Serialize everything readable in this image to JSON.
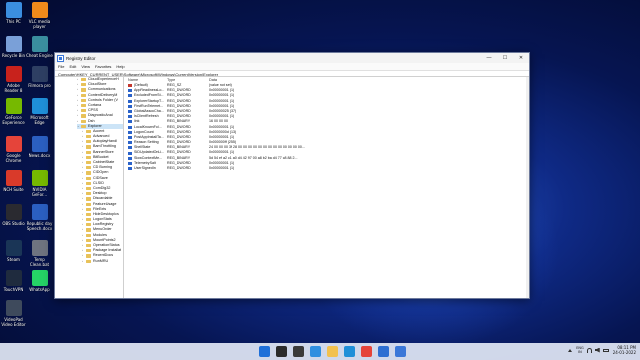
{
  "desktop": {
    "icons": [
      {
        "label": "This PC",
        "color": "#3b8ee0"
      },
      {
        "label": "VLC media player",
        "color": "#f08a1b"
      },
      {
        "label": "Recycle Bin",
        "color": "#7aa0d8"
      },
      {
        "label": "Cheat Engine",
        "color": "#3a8e9e"
      },
      {
        "label": "Adobe Reader 8",
        "color": "#c8221c"
      },
      {
        "label": "Filmora pro",
        "color": "#2e3f63"
      },
      {
        "label": "GeForce Experience",
        "color": "#76b900"
      },
      {
        "label": "Microsoft Edge",
        "color": "#1f8fd8"
      },
      {
        "label": "Google Chrome",
        "color": "#e5443a"
      },
      {
        "label": "News.docx",
        "color": "#2b5fc1"
      },
      {
        "label": "NCH Suite",
        "color": "#d93a2a"
      },
      {
        "label": "NVIDIA GeFor...",
        "color": "#76b900"
      },
      {
        "label": "OBS Studio",
        "color": "#2a2a30"
      },
      {
        "label": "Republic day Speech.docx",
        "color": "#2b5fc1"
      },
      {
        "label": "Steam",
        "color": "#1a3556"
      },
      {
        "label": "Temp Clean.bat",
        "color": "#6f7480"
      },
      {
        "label": "TouchVPN",
        "color": "#1f2b3e"
      },
      {
        "label": "WhatsApp",
        "color": "#25d366"
      },
      {
        "label": "VideoPad Video Editor",
        "color": "#3e4a5c"
      }
    ]
  },
  "window": {
    "title": "Registry Editor",
    "controls": {
      "minimize": "—",
      "maximize": "☐",
      "close": "✕"
    },
    "menu": [
      "File",
      "Edit",
      "View",
      "Favorites",
      "Help"
    ],
    "address": "Computer\\HKEY_CURRENT_USER\\Software\\Microsoft\\Windows\\CurrentVersion\\Explorer",
    "tree": {
      "parents": [
        "CloudExperienceH",
        "CloudStore",
        "Communications",
        "ContentDeliveryM",
        "Controls Folder (V",
        "Cortana",
        "CPSS",
        "DiagnosticAnal",
        "Dsh",
        "Explorer"
      ],
      "children": [
        "Accent",
        "Advanced",
        "AutoplayHandl",
        "BamThrottling",
        "BannerStore",
        "BitBucket",
        "CabinetState",
        "CD Burning",
        "CIDOpen",
        "CIDSave",
        "CLSID",
        "ComDlg32",
        "Desktop",
        "Discardable",
        "FeatureUsage",
        "FileExts",
        "HideDesktopIcs",
        "LogonStats",
        "LowRegistry",
        "MenuOrder",
        "Modules",
        "MountPoints2",
        "OperationStatus",
        "Package Installat",
        "RecentDocs",
        "RunMRU"
      ]
    },
    "columns": {
      "name": "Name",
      "type": "Type",
      "data": "Data"
    },
    "values": [
      {
        "name": "(Default)",
        "type": "REG_SZ",
        "data": "(value not set)",
        "kind": "sz"
      },
      {
        "name": "AppReadinessLo...",
        "type": "REG_DWORD",
        "data": "0x00000001 (1)",
        "kind": "bn"
      },
      {
        "name": "ExcludedFromSt...",
        "type": "REG_DWORD",
        "data": "0x00000001 (1)",
        "kind": "bn"
      },
      {
        "name": "ExplorerStartupT...",
        "type": "REG_DWORD",
        "data": "0x00000001 (1)",
        "kind": "bn"
      },
      {
        "name": "FirstRunTelemet...",
        "type": "REG_DWORD",
        "data": "0x00000001 (1)",
        "kind": "bn"
      },
      {
        "name": "GlobalAssocCha...",
        "type": "REG_DWORD",
        "data": "0x00000025 (37)",
        "kind": "bn"
      },
      {
        "name": "IsClientRefresh",
        "type": "REG_DWORD",
        "data": "0x00000001 (1)",
        "kind": "bn"
      },
      {
        "name": "link",
        "type": "REG_BINARY",
        "data": "16 00 00 00",
        "kind": "bn"
      },
      {
        "name": "LocalKnownFol...",
        "type": "REG_DWORD",
        "data": "0x00000001 (1)",
        "kind": "bn"
      },
      {
        "name": "LogonCount",
        "type": "REG_DWORD",
        "data": "0x0000000d (13)",
        "kind": "bn"
      },
      {
        "name": "PostAppInstallTa...",
        "type": "REG_DWORD",
        "data": "0x00000001 (1)",
        "kind": "bn"
      },
      {
        "name": "Reason Setting",
        "type": "REG_DWORD",
        "data": "0x000000ff (255)",
        "kind": "bn"
      },
      {
        "name": "ShellState",
        "type": "REG_BINARY",
        "data": "24 00 00 00 3f 28 00 00 00 00 00 00 00 00 00 00 00 00 00...",
        "kind": "bn"
      },
      {
        "name": "SIDUpdatedOnLi...",
        "type": "REG_DWORD",
        "data": "0x00000001 (1)",
        "kind": "bn"
      },
      {
        "name": "SlowContextMe...",
        "type": "REG_BINARY",
        "data": "5d 54 ef a2 c1 a0 d4 42 97 00 a8 b2 ba d4 77 c8 88 2...",
        "kind": "bn"
      },
      {
        "name": "TelemetrySalt",
        "type": "REG_DWORD",
        "data": "0x00000001 (1)",
        "kind": "bn"
      },
      {
        "name": "UserSignedIn",
        "type": "REG_DWORD",
        "data": "0x00000001 (1)",
        "kind": "bn"
      }
    ]
  },
  "taskbar": {
    "apps": [
      {
        "name": "start-icon",
        "color": "#1e6fd9"
      },
      {
        "name": "search-icon",
        "color": "#2b2b2b"
      },
      {
        "name": "task-view-icon",
        "color": "#3a3a3a"
      },
      {
        "name": "widgets-icon",
        "color": "#2f8fe0"
      },
      {
        "name": "file-explorer-icon",
        "color": "#f2c14e"
      },
      {
        "name": "edge-icon",
        "color": "#1f8fd8"
      },
      {
        "name": "chrome-icon",
        "color": "#e5443a"
      },
      {
        "name": "store-icon",
        "color": "#2d6fd2"
      },
      {
        "name": "registry-icon",
        "color": "#3a77d8"
      }
    ],
    "lang_top": "ENG",
    "lang_bottom": "IN",
    "time": "08:11 PM",
    "date": "24-01-2022"
  }
}
